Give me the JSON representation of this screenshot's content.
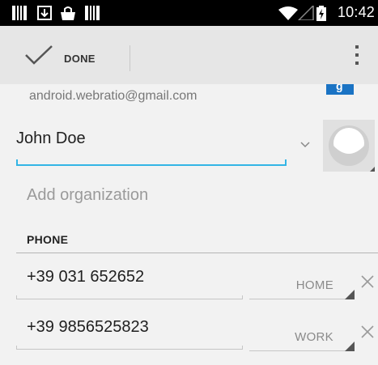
{
  "status_bar": {
    "time": "10:42",
    "icons": [
      "notification-icon",
      "download-icon",
      "shopping-bag-icon",
      "notification-icon",
      "wifi-icon",
      "signal-icon",
      "battery-charging-icon"
    ]
  },
  "action_bar": {
    "done_label": "DONE",
    "overflow_icon": "overflow-menu-icon"
  },
  "account": {
    "email": "android.webratio@gmail.com",
    "badge_letter": "g"
  },
  "contact": {
    "name": "John Doe",
    "organization_placeholder": "Add organization"
  },
  "phone_section": {
    "title": "PHONE",
    "entries": [
      {
        "number": "+39 031 652652",
        "type": "HOME"
      },
      {
        "number": "+39 9856525823",
        "type": "WORK"
      }
    ]
  },
  "colors": {
    "accent": "#33b5e5",
    "status_bar": "#000000",
    "action_bar": "#e6e6e6",
    "background": "#f2f2f2"
  }
}
